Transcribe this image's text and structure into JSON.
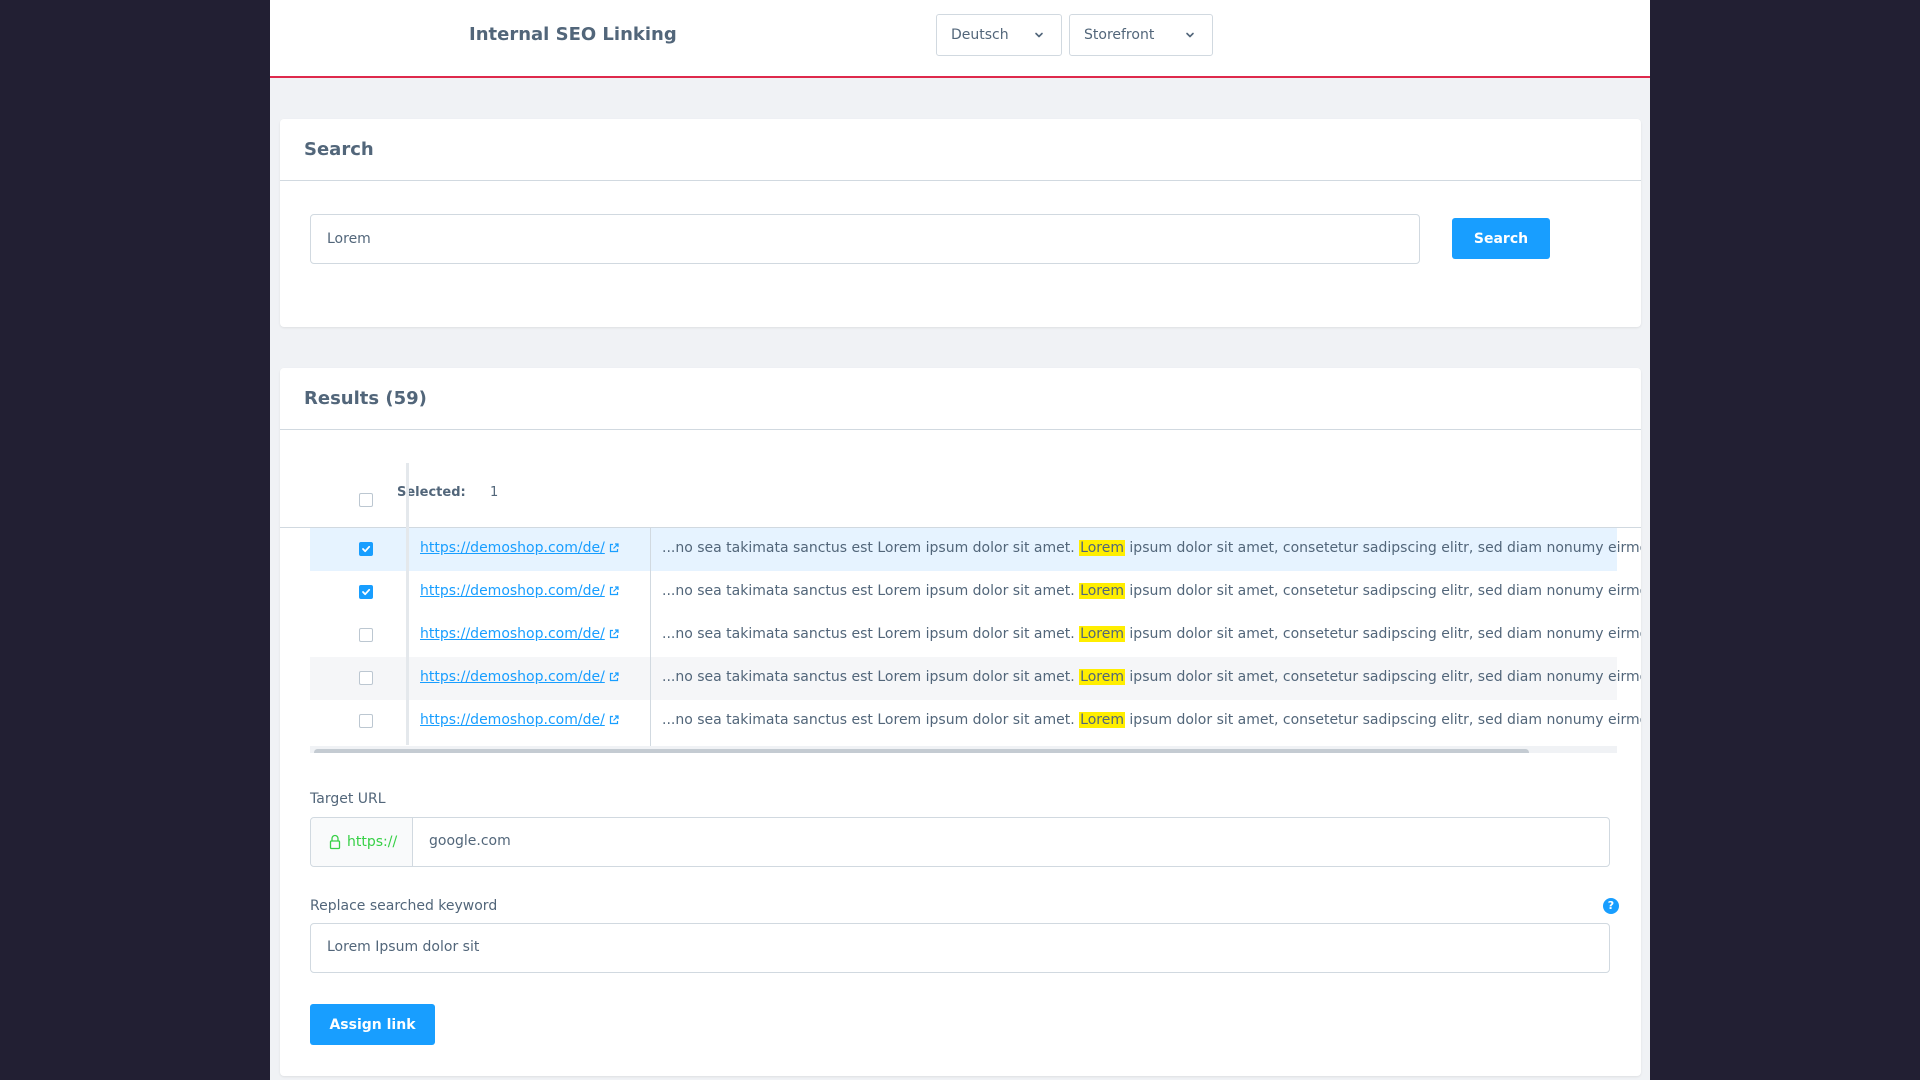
{
  "header": {
    "title": "Internal SEO Linking",
    "language_select": "Deutsch",
    "saleschannel_select": "Storefront"
  },
  "search_card": {
    "title": "Search",
    "input_value": "Lorem",
    "button_label": "Search"
  },
  "results_card": {
    "title": "Results (59)",
    "selected_label": "Selected:",
    "selected_count": "1",
    "rows": [
      {
        "url": "https://demoshop.com/de/",
        "checked": true,
        "snippet_before": "...no sea takimata sanctus est Lorem ipsum dolor sit amet. ",
        "highlight": "Lorem",
        "snippet_after": " ipsum dolor sit amet, consetetur sadipscing elitr, sed diam nonumy eirmod"
      },
      {
        "url": "https://demoshop.com/de/",
        "checked": true,
        "snippet_before": "...no sea takimata sanctus est Lorem ipsum dolor sit amet. ",
        "highlight": "Lorem",
        "snippet_after": " ipsum dolor sit amet, consetetur sadipscing elitr, sed diam nonumy eirmod"
      },
      {
        "url": "https://demoshop.com/de/",
        "checked": false,
        "snippet_before": "...no sea takimata sanctus est Lorem ipsum dolor sit amet. ",
        "highlight": "Lorem",
        "snippet_after": " ipsum dolor sit amet, consetetur sadipscing elitr, sed diam nonumy eirmod"
      },
      {
        "url": "https://demoshop.com/de/",
        "checked": false,
        "snippet_before": "...no sea takimata sanctus est Lorem ipsum dolor sit amet. ",
        "highlight": "Lorem",
        "snippet_after": " ipsum dolor sit amet, consetetur sadipscing elitr, sed diam nonumy eirmod"
      },
      {
        "url": "https://demoshop.com/de/",
        "checked": false,
        "snippet_before": "...no sea takimata sanctus est Lorem ipsum dolor sit amet. ",
        "highlight": "Lorem",
        "snippet_after": " ipsum dolor sit amet, consetetur sadipscing elitr, sed diam nonumy eirmod"
      }
    ],
    "target_url": {
      "label": "Target URL",
      "prefix": "https://",
      "value": "google.com"
    },
    "replace_keyword": {
      "label": "Replace searched keyword",
      "value": "Lorem Ipsum dolor sit",
      "help_glyph": "?"
    },
    "assign_button_label": "Assign link"
  },
  "colors": {
    "accent": "#189eff",
    "header_border": "#de294c",
    "highlight": "#ffee00",
    "secure_prefix": "#37d046"
  }
}
